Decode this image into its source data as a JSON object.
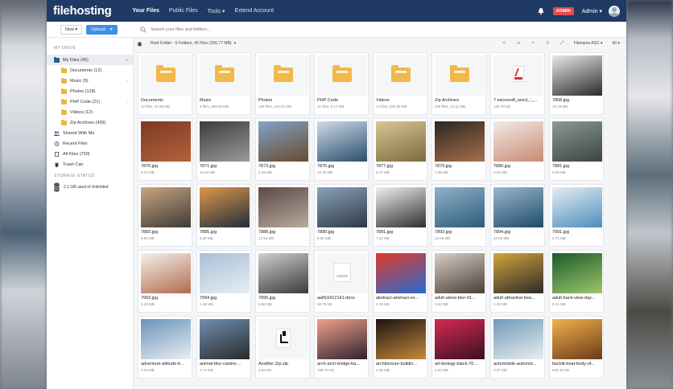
{
  "nav": {
    "logo": "filehosting",
    "items": [
      "Your Files",
      "Public Files",
      "Tools ▾",
      "Extend Account"
    ],
    "badge": "ADMIN",
    "user": "Admin ▾"
  },
  "toolbar": {
    "new_label": "New ▾",
    "upload_label": "Upload",
    "upload_caret": "▾",
    "search_placeholder": "Search your files and folders..."
  },
  "sidebar": {
    "drive_heading": "MY DRIVE",
    "my_files": "My Files (45)",
    "folders": [
      "Documents (12)",
      "Music (5)",
      "Photos (128)",
      "PHP Code (21)",
      "Videos (12)",
      "Zip Archives (439)"
    ],
    "shared": "Shared With Me",
    "recent": "Recent Files",
    "all_files": "All Files (700)",
    "trash": "Trash Can",
    "storage_heading": "STORAGE STATUS",
    "storage_text": "2.1 GB used of Unlimited"
  },
  "crumb": {
    "text": "Root Folder - 6 Folders, 45 Files (256.77 MB)",
    "caret": "▾",
    "sort": "Filename ASC ▾",
    "per_page": "50 ▾"
  },
  "colors": {
    "nav_bg": "#1f3a64",
    "accent": "#3d8fe6",
    "badge": "#e24b4b",
    "folder": "#f1b84a"
  },
  "items": [
    {
      "kind": "folder",
      "title": "Documents",
      "meta": "12 files, 34.09 MB"
    },
    {
      "kind": "folder",
      "title": "Music",
      "meta": "5 files, 869.56 MB"
    },
    {
      "kind": "folder",
      "title": "Photos",
      "meta": "128 files, 144.24 MB"
    },
    {
      "kind": "folder",
      "title": "PHP Code",
      "meta": "21 files, 5.17 MB"
    },
    {
      "kind": "folder",
      "title": "Videos",
      "meta": "12 files, 225.96 MB"
    },
    {
      "kind": "folder",
      "title": "Zip Archives",
      "meta": "439 files, 13.11 MB"
    },
    {
      "kind": "pdf",
      "title": "7 microsoft_word_-_...",
      "meta": "125.78 KB"
    },
    {
      "kind": "photo",
      "title": "7868.jpg",
      "meta": "10.29 MB",
      "c1": "#e9e9e9",
      "c2": "#2b2b2b"
    },
    {
      "kind": "photo",
      "title": "7870.jpg",
      "meta": "9.22 MB",
      "c1": "#7a3a24",
      "c2": "#b5623a"
    },
    {
      "kind": "photo",
      "title": "7871.jpg",
      "meta": "12.54 MB",
      "c1": "#3c3c3c",
      "c2": "#9a9a9a"
    },
    {
      "kind": "photo",
      "title": "7873.jpg",
      "meta": "4.29 MB",
      "c1": "#7fa3c7",
      "c2": "#6b4a2e"
    },
    {
      "kind": "photo",
      "title": "7875.jpg",
      "meta": "10.26 MB",
      "c1": "#cfdbe8",
      "c2": "#2a4d6e"
    },
    {
      "kind": "photo",
      "title": "7877.jpg",
      "meta": "6.47 MB",
      "c1": "#d9c694",
      "c2": "#7a6a3e"
    },
    {
      "kind": "photo",
      "title": "7879.jpg",
      "meta": "7.09 MB",
      "c1": "#2b2623",
      "c2": "#a96f4a"
    },
    {
      "kind": "photo",
      "title": "7880.jpg",
      "meta": "6.94 MB",
      "c1": "#f1ebe6",
      "c2": "#c78a73"
    },
    {
      "kind": "photo",
      "title": "7881.jpg",
      "meta": "6.63 MB",
      "c1": "#8c9a94",
      "c2": "#3a4440"
    },
    {
      "kind": "photo",
      "title": "7883.jpg",
      "meta": "5.93 MB",
      "c1": "#c9a583",
      "c2": "#3e3a34"
    },
    {
      "kind": "photo",
      "title": "7885.jpg",
      "meta": "8.38 MB",
      "c1": "#e0964a",
      "c2": "#1f2e3d"
    },
    {
      "kind": "photo",
      "title": "7888.jpg",
      "meta": "17.54 MB",
      "c1": "#5a4a46",
      "c2": "#b7aa9e"
    },
    {
      "kind": "photo",
      "title": "7890.jpg",
      "meta": "9.60 MB",
      "c1": "#8ba3b8",
      "c2": "#2d3846"
    },
    {
      "kind": "photo",
      "title": "7891.jpg",
      "meta": "7.32 MB",
      "c1": "#f0f0f0",
      "c2": "#2e2e2e"
    },
    {
      "kind": "photo",
      "title": "7893.jpg",
      "meta": "10.09 MB",
      "c1": "#8fb2c8",
      "c2": "#2e5a7a"
    },
    {
      "kind": "photo",
      "title": "7894.jpg",
      "meta": "10.95 MB",
      "c1": "#9ab7cc",
      "c2": "#1e4a6a"
    },
    {
      "kind": "photo",
      "title": "7991.jpg",
      "meta": "5.76 MB",
      "c1": "#e6ecf1",
      "c2": "#4b8fbd"
    },
    {
      "kind": "photo",
      "title": "7993.jpg",
      "meta": "5.16 MB",
      "c1": "#f4f1ea",
      "c2": "#b26a4e"
    },
    {
      "kind": "photo",
      "title": "7994.jpg",
      "meta": "1.48 MB",
      "c1": "#a9bfd6",
      "c2": "#e7edf3"
    },
    {
      "kind": "photo",
      "title": "7995.jpg",
      "meta": "6.88 MB",
      "c1": "#cfcfcf",
      "c2": "#3a3a3a"
    },
    {
      "kind": "docx",
      "title": "aatf16412141.docx",
      "meta": "50.79 KB"
    },
    {
      "kind": "photo",
      "title": "abstract-abstract-ex...",
      "meta": "4.29 MB",
      "c1": "#e03a2a",
      "c2": "#2a6ad0"
    },
    {
      "kind": "photo",
      "title": "adult-alone-blur-91...",
      "meta": "3.52 MB",
      "c1": "#d8cfc6",
      "c2": "#4a3e38"
    },
    {
      "kind": "photo",
      "title": "adult-attractive-bea...",
      "meta": "4.28 MB",
      "c1": "#d3a43a",
      "c2": "#2b2b2b"
    },
    {
      "kind": "photo",
      "title": "adult-back-view-day...",
      "meta": "5.21 MB",
      "c1": "#1d5a2a",
      "c2": "#9bc66a"
    },
    {
      "kind": "photo",
      "title": "adventure-altitude-b...",
      "meta": "2.03 MB",
      "c1": "#6a93b8",
      "c2": "#e9eef3"
    },
    {
      "kind": "photo",
      "title": "animal-blur-canine-...",
      "meta": "5.74 MB",
      "c1": "#6f8fb0",
      "c2": "#2a2a2a"
    },
    {
      "kind": "zip",
      "title": "Another Zip.zip",
      "meta": "3.83 KB"
    },
    {
      "kind": "photo",
      "title": "arch-arch-bridge-ba...",
      "meta": "198.70 KB",
      "c1": "#f3a08a",
      "c2": "#2e2230"
    },
    {
      "kind": "photo",
      "title": "architecture-buildin...",
      "meta": "2.38 MB",
      "c1": "#1a1410",
      "c2": "#c8893a"
    },
    {
      "kind": "photo",
      "title": "art-biology-black-70...",
      "meta": "2.03 MB",
      "c1": "#d62a52",
      "c2": "#3a1020"
    },
    {
      "kind": "photo",
      "title": "automobile-automot...",
      "meta": "3.37 MB",
      "c1": "#6f9ab8",
      "c2": "#e9edf0"
    },
    {
      "kind": "photo",
      "title": "backlit-boat-body-of...",
      "meta": "636.33 KB",
      "c1": "#f1b24a",
      "c2": "#6a3a1a"
    }
  ]
}
